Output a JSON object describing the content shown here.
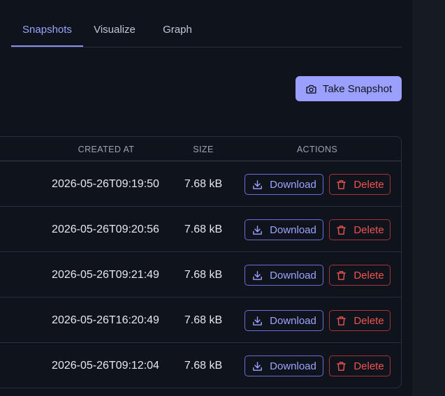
{
  "tabs": [
    {
      "label": "Snapshots",
      "active": true
    },
    {
      "label": "Visualize",
      "active": false
    },
    {
      "label": "Graph",
      "active": false
    }
  ],
  "toolbar": {
    "take_snapshot_label": "Take Snapshot",
    "take_snapshot_icon": "camera-icon"
  },
  "table": {
    "headers": {
      "created_at": "CREATED AT",
      "size": "SIZE",
      "actions": "ACTIONS"
    },
    "rows": [
      {
        "created_at": "2026-05-26T09:19:50",
        "size": "7.68 kB"
      },
      {
        "created_at": "2026-05-26T09:20:56",
        "size": "7.68 kB"
      },
      {
        "created_at": "2026-05-26T09:21:49",
        "size": "7.68 kB"
      },
      {
        "created_at": "2026-05-26T16:20:49",
        "size": "7.68 kB"
      },
      {
        "created_at": "2026-05-26T09:12:04",
        "size": "7.68 kB"
      }
    ],
    "actions": {
      "download_label": "Download",
      "download_icon": "download-icon",
      "delete_label": "Delete",
      "delete_icon": "trash-icon"
    }
  },
  "colors": {
    "accent": "#9ba0ff",
    "danger": "#ef5350",
    "background": "#0f131c"
  }
}
